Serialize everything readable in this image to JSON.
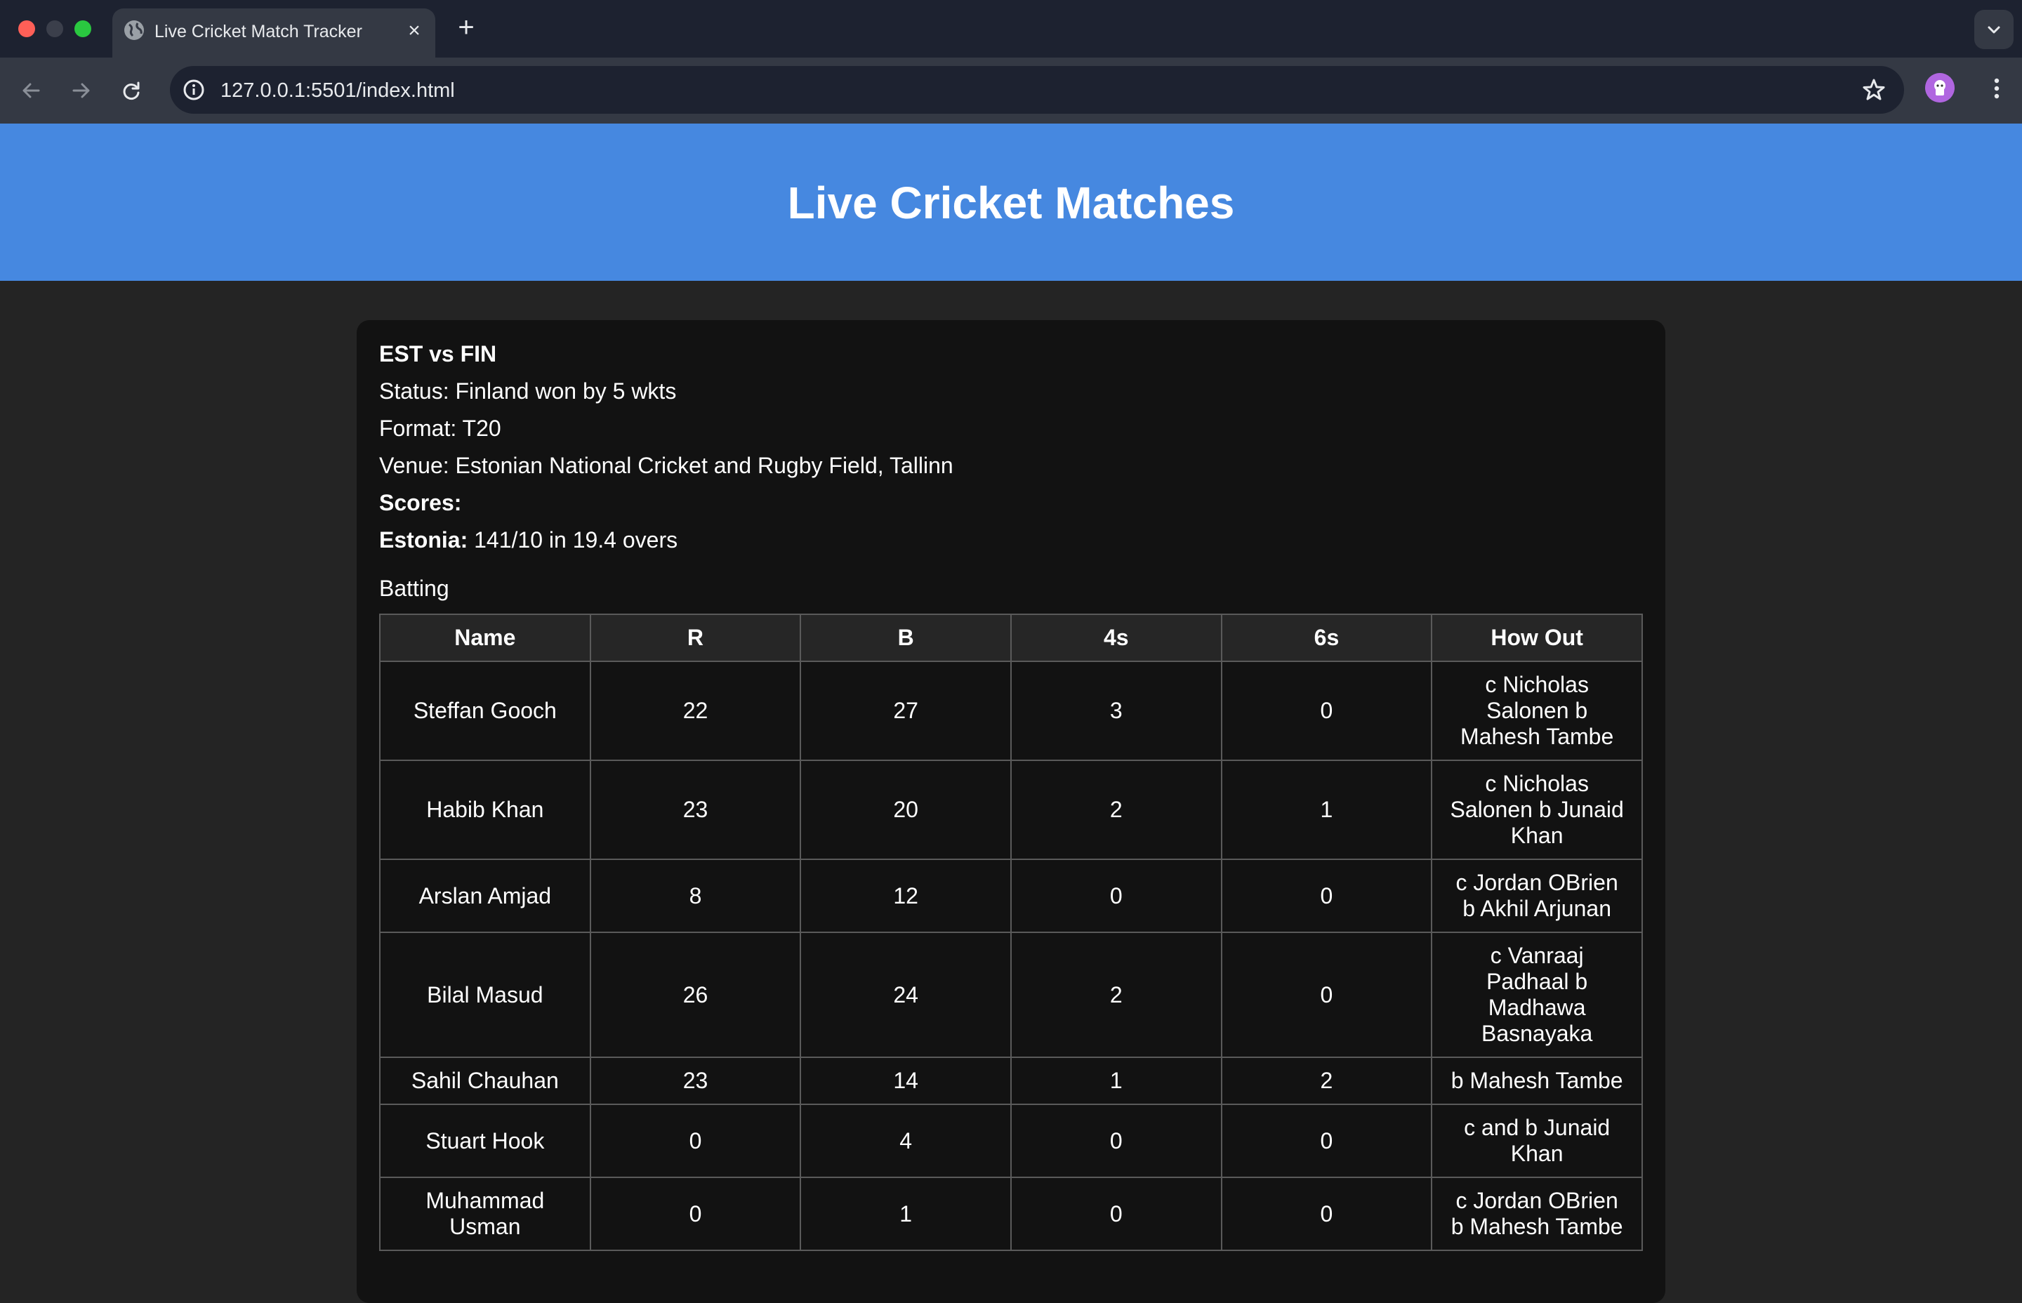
{
  "browser": {
    "tab_title": "Live Cricket Match Tracker",
    "url": "127.0.0.1:5501/index.html"
  },
  "page": {
    "title": "Live Cricket Matches"
  },
  "match": {
    "teams": "EST vs FIN",
    "status_label": "Status:",
    "status": "Finland won by 5 wkts",
    "format_label": "Format:",
    "format": "T20",
    "venue_label": "Venue:",
    "venue": "Estonian National Cricket and Rugby Field, Tallinn",
    "scores_label": "Scores:",
    "innings": [
      {
        "team": "Estonia:",
        "score": "141/10 in 19.4 overs"
      }
    ],
    "batting_caption": "Batting",
    "batting_columns": [
      "Name",
      "R",
      "B",
      "4s",
      "6s",
      "How Out"
    ],
    "batting_rows": [
      {
        "name": "Steffan Gooch",
        "r": "22",
        "b": "27",
        "fours": "3",
        "sixes": "0",
        "how_out": "c Nicholas Salonen b Mahesh Tambe"
      },
      {
        "name": "Habib Khan",
        "r": "23",
        "b": "20",
        "fours": "2",
        "sixes": "1",
        "how_out": "c Nicholas Salonen b Junaid Khan"
      },
      {
        "name": "Arslan Amjad",
        "r": "8",
        "b": "12",
        "fours": "0",
        "sixes": "0",
        "how_out": "c Jordan OBrien b Akhil Arjunan"
      },
      {
        "name": "Bilal Masud",
        "r": "26",
        "b": "24",
        "fours": "2",
        "sixes": "0",
        "how_out": "c Vanraaj Padhaal b Madhawa Basnayaka"
      },
      {
        "name": "Sahil Chauhan",
        "r": "23",
        "b": "14",
        "fours": "1",
        "sixes": "2",
        "how_out": "b Mahesh Tambe"
      },
      {
        "name": "Stuart Hook",
        "r": "0",
        "b": "4",
        "fours": "0",
        "sixes": "0",
        "how_out": "c and b Junaid Khan"
      },
      {
        "name": "Muhammad Usman",
        "r": "0",
        "b": "1",
        "fours": "0",
        "sixes": "0",
        "how_out": "c Jordan OBrien b Mahesh Tambe"
      }
    ]
  }
}
